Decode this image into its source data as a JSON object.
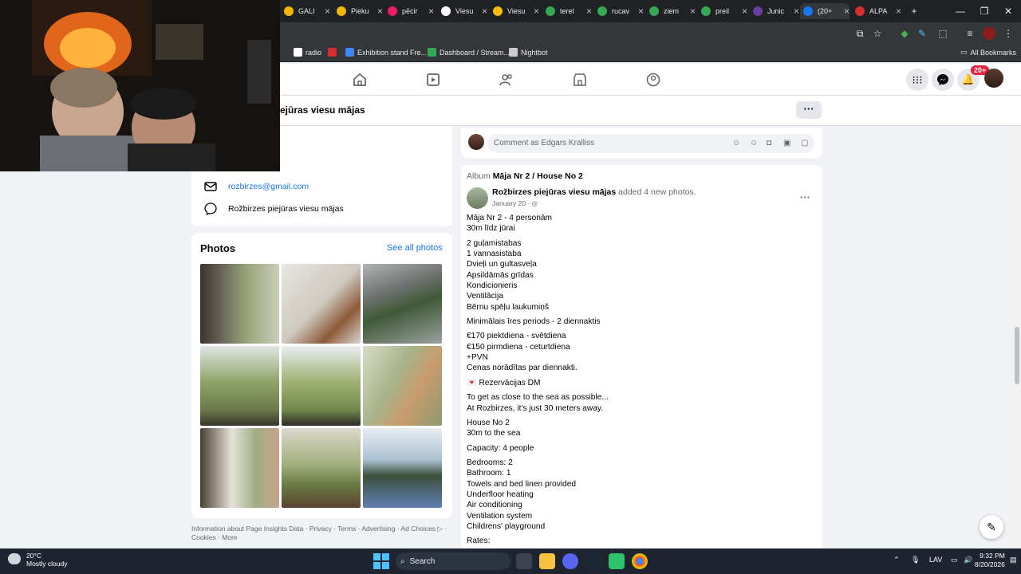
{
  "browser": {
    "tabs": [
      {
        "label": "GALI",
        "color": "#f4b400"
      },
      {
        "label": "Pieku",
        "color": "#f4b400"
      },
      {
        "label": "pēcir",
        "color": "#e91e63"
      },
      {
        "label": "Viesu",
        "color": "#ffffff"
      },
      {
        "label": "Viesu",
        "color": "#fbbc04"
      },
      {
        "label": "terel",
        "color": "#34a853"
      },
      {
        "label": "rucav",
        "color": "#34a853"
      },
      {
        "label": "ziem",
        "color": "#34a853"
      },
      {
        "label": "preil",
        "color": "#34a853"
      },
      {
        "label": "Junic",
        "color": "#6b3fa0"
      },
      {
        "label": "(20+",
        "color": "#1877f2"
      },
      {
        "label": "ALPA",
        "color": "#d32f2f"
      }
    ],
    "new_tab": "+",
    "bookmarks": [
      {
        "label": "radio",
        "color": "#ffffff"
      },
      {
        "label": "",
        "color": "#d32f2f"
      },
      {
        "label": "Exhibition stand Fre...",
        "color": "#4285f4"
      },
      {
        "label": "Dashboard / Stream...",
        "color": "#34a853"
      },
      {
        "label": "Nightbot",
        "color": "#cccccc"
      }
    ],
    "all_bookmarks": "All Bookmarks"
  },
  "fb": {
    "notif_badge": "20+",
    "page_title": "ejūras viesu mājas",
    "intro": {
      "email": "rozbirzes@gmail.com",
      "messenger": "Rožbirzes piejūras viesu mājas"
    },
    "photos": {
      "title": "Photos",
      "see_all": "See all photos"
    },
    "footer": "Information about Page Insights Data · Privacy · Terms · Advertising · Ad Choices ▷ · Cookies · More",
    "comment_placeholder": "Comment as Edgars Kralliss",
    "post": {
      "album_prefix": "Album",
      "album_name": "Māja Nr 2 / House No 2",
      "author": "Rožbirzes piejūras viesu mājas",
      "action": "added 4 new photos.",
      "date": "January 20 · ◎",
      "paragraphs": [
        "Māja Nr 2 - 4 personām\n30m līdz jūrai",
        "2 guļamistabas\n1 vannasistaba\nDvieļi un gultasveļa\nApsildāmās grīdas\nKondicionieris\nVentilācija\nBērnu spēļu laukumiņš",
        "Minimālais īres periods - 2 diennaktis",
        "€170 piektdiena - svētdiena\n€150 pirmdiena - ceturtdiena\n+PVN\nCenas norādītas par diennakti.",
        "💌 Rezervācijas DM",
        "To get as close to the sea as possible...\nAt Rozbirzes, it's just 30 meters away.",
        "House No 2\n30m to the sea",
        "Capacity: 4 people",
        "Bedrooms: 2\nBathroom: 1\nTowels and bed linen provided\nUnderfloor heating\nAir conditioning\nVentilation system\nChildrens' playground",
        "Rates:"
      ]
    }
  },
  "taskbar": {
    "weather_temp": "20°C",
    "weather_desc": "Mostly cloudy",
    "search": "Search",
    "lang": "LAV",
    "time": "9:32 PM",
    "date": "8/20/2026"
  }
}
